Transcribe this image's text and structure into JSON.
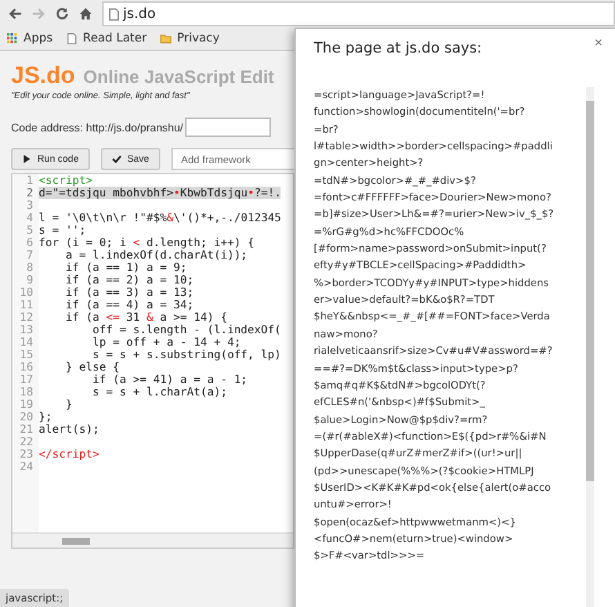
{
  "browser": {
    "address": "js.do",
    "bookmarks": [
      {
        "label": "Apps",
        "kind": "apps"
      },
      {
        "label": "Read Later",
        "kind": "page"
      },
      {
        "label": "Privacy",
        "kind": "folder"
      }
    ]
  },
  "page": {
    "logo": "JS.do",
    "title": "Online JavaScript Edit",
    "tagline": "\"Edit your code online. Simple, light and fast\"",
    "code_address_label": "Code address: http://js.do/pranshu/",
    "buttons": [
      {
        "label": "Run code",
        "kind": "run"
      },
      {
        "label": "Save",
        "kind": "save"
      }
    ],
    "framework": {
      "placeholder": "Add framework"
    }
  },
  "editor": {
    "lines": [
      {
        "number": "1",
        "highlighted": false,
        "segments": [
          {
            "text": "<script>",
            "kind": "open-tag"
          }
        ]
      },
      {
        "number": "2",
        "highlighted": true,
        "segments": [
          {
            "text": "d=\"=tdsjqu mbohvbhf>",
            "kind": "plain"
          },
          {
            "text": "•",
            "kind": "special"
          },
          {
            "text": "KbwbTdsjqu",
            "kind": "plain"
          },
          {
            "text": "•",
            "kind": "special"
          },
          {
            "text": "?=!.",
            "kind": "plain"
          }
        ]
      },
      {
        "number": "3",
        "highlighted": false
      },
      {
        "number": "4",
        "highlighted": false,
        "segments": [
          {
            "text": "l = '\\0\\t\\n\\r !\"#$%",
            "kind": "plain"
          },
          {
            "text": "&",
            "kind": "operator"
          },
          {
            "text": "\\'()*+,-./012345",
            "kind": "plain"
          }
        ]
      },
      {
        "number": "5",
        "highlighted": false,
        "segments": [
          {
            "text": "s = '';",
            "kind": "plain"
          }
        ]
      },
      {
        "number": "6",
        "highlighted": false,
        "segments": [
          {
            "text": "for (i = 0; i ",
            "kind": "plain"
          },
          {
            "text": "<",
            "kind": "operator"
          },
          {
            "text": " d.length; i++) {",
            "kind": "plain"
          }
        ]
      },
      {
        "number": "7",
        "highlighted": false,
        "segments": [
          {
            "text": "    a = l.indexOf(d.charAt(i));",
            "kind": "plain"
          }
        ]
      },
      {
        "number": "8",
        "highlighted": false,
        "segments": [
          {
            "text": "    if (a == 1) a = 9;",
            "kind": "plain"
          }
        ]
      },
      {
        "number": "9",
        "highlighted": false,
        "segments": [
          {
            "text": "    if (a == 2) a = 10;",
            "kind": "plain"
          }
        ]
      },
      {
        "number": "10",
        "highlighted": false,
        "segments": [
          {
            "text": "    if (a == 3) a = 13;",
            "kind": "plain"
          }
        ]
      },
      {
        "number": "11",
        "highlighted": false,
        "segments": [
          {
            "text": "    if (a == 4) a = 34;",
            "kind": "plain"
          }
        ]
      },
      {
        "number": "12",
        "highlighted": false,
        "segments": [
          {
            "text": "    if (a ",
            "kind": "plain"
          },
          {
            "text": "<=",
            "kind": "operator"
          },
          {
            "text": " 31 ",
            "kind": "plain"
          },
          {
            "text": "&",
            "kind": "operator"
          },
          {
            "text": " a >= 14) {",
            "kind": "plain"
          }
        ]
      },
      {
        "number": "13",
        "highlighted": false,
        "segments": [
          {
            "text": "        off = s.length - (l.indexOf(",
            "kind": "plain"
          }
        ]
      },
      {
        "number": "14",
        "highlighted": false,
        "segments": [
          {
            "text": "        lp = off + a - 14 + 4;",
            "kind": "plain"
          }
        ]
      },
      {
        "number": "15",
        "highlighted": false,
        "segments": [
          {
            "text": "        s = s + s.substring(off, lp)",
            "kind": "plain"
          }
        ]
      },
      {
        "number": "16",
        "highlighted": false,
        "segments": [
          {
            "text": "    } else {",
            "kind": "plain"
          }
        ]
      },
      {
        "number": "17",
        "highlighted": false,
        "segments": [
          {
            "text": "        if (a >= 41) a = a - 1;",
            "kind": "plain"
          }
        ]
      },
      {
        "number": "18",
        "highlighted": false,
        "segments": [
          {
            "text": "        s = s + l.charAt(a);",
            "kind": "plain"
          }
        ]
      },
      {
        "number": "19",
        "highlighted": false,
        "segments": [
          {
            "text": "    }",
            "kind": "plain"
          }
        ]
      },
      {
        "number": "20",
        "highlighted": false,
        "segments": [
          {
            "text": "};",
            "kind": "plain"
          }
        ]
      },
      {
        "number": "21",
        "highlighted": false,
        "segments": [
          {
            "text": "alert(s);",
            "kind": "plain"
          }
        ]
      },
      {
        "number": "22",
        "highlighted": false
      },
      {
        "number": "23",
        "highlighted": false,
        "segments": [
          {
            "text": "</script>",
            "kind": "close-tag"
          }
        ]
      },
      {
        "number": "24",
        "highlighted": false
      }
    ]
  },
  "dialog": {
    "title": "The page at js.do says:",
    "close": "×",
    "lines": [
      "=script>language>JavaScript?=!",
      "function>showlogin(documentiteln('=br?",
      "=br?",
      "l#table>width>>border>cellspacing>#paddli",
      "gn>center>height>?",
      "=tdN#>bgcolor>#_#_#div>$?",
      "=font>c#FFFFFF>face>Dourier>New>mono?",
      "=b]#size>User>Lh&=#?=urier>New>iv_$_$?",
      "=%rG#g%d>hc%FFCDOOc%",
      "[#form>name>password>onSubmit>input(?",
      "efty#y#TBCLE>cellSpacing>#Paddidth>",
      "%>border>TCODYy#y#INPUT>type>hiddens",
      "er>value>default?=bK&o$R?=TDT",
      "$heY&&nbsp<=_#_#[##=FONT>face>Verda",
      "naw>mono?",
      "rialelveticaansrif>size>Cv#u#V#assword=#?",
      "==#?=DK%m$t&class>input>type>p?",
      "$amq#q#K$&tdN#>bgcolODYt(?",
      "efCLES#n('&nbsp<)#f$Submit>_",
      "$alue>Login>Now@$p$div?=rm?",
      "=(#r(#ableX#)<function>E$({pd>r#%&i#N",
      "$UpperDase(q#urZ#merZ#if>((ur!>ur||",
      "(pd>>unescape(%%%>(?$cookie>HTMLPJ",
      "$UserID><K#K#K#pd<ok{else{alert(o#acco",
      "untu#>error>!",
      "$open(ocaz&ef>httpwwwetmanm<)<}",
      "<funcO#>nem(eturn>true)<window>",
      "$>F#<var>tdl>>>="
    ]
  },
  "status_bar": "javascript:;"
}
